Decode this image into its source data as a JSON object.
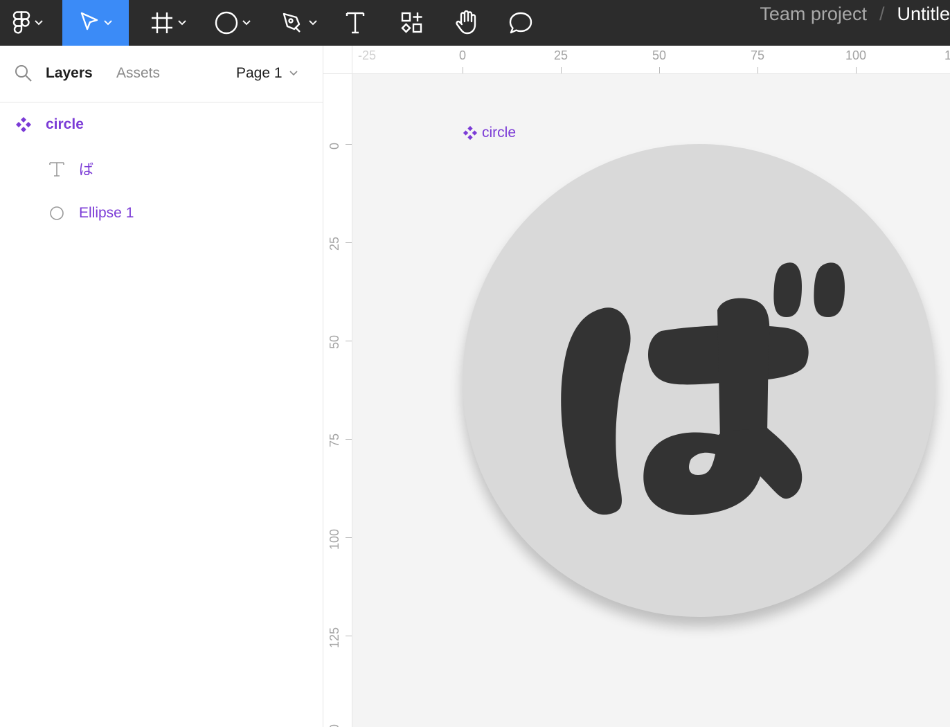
{
  "toolbar": {
    "tools": [
      {
        "name": "figma-menu",
        "icon": "figma-logo-icon"
      },
      {
        "name": "move-tool",
        "icon": "cursor-icon",
        "active": true
      },
      {
        "name": "frame-tool",
        "icon": "frame-icon"
      },
      {
        "name": "shape-tool",
        "icon": "ellipse-icon"
      },
      {
        "name": "pen-tool",
        "icon": "pen-icon"
      },
      {
        "name": "text-tool",
        "icon": "text-icon"
      },
      {
        "name": "resources-tool",
        "icon": "resources-icon"
      },
      {
        "name": "hand-tool",
        "icon": "hand-icon"
      },
      {
        "name": "comment-tool",
        "icon": "comment-icon"
      }
    ],
    "breadcrumb": {
      "team": "Team project",
      "separator": "/",
      "file": "Untitle"
    }
  },
  "left_panel": {
    "tabs": {
      "layers": "Layers",
      "assets": "Assets"
    },
    "page": "Page 1",
    "layers": [
      {
        "name": "circle",
        "type": "component",
        "icon": "component-icon"
      },
      {
        "name": "ば",
        "type": "text",
        "icon": "text-layer-icon"
      },
      {
        "name": "Ellipse 1",
        "type": "ellipse",
        "icon": "ellipse-layer-icon"
      }
    ]
  },
  "canvas": {
    "ruler_h": [
      "-25",
      "0",
      "25",
      "50",
      "75",
      "100",
      "1"
    ],
    "ruler_v": [
      "0",
      "25",
      "50",
      "75",
      "100",
      "125",
      "0"
    ],
    "frame_label": "circle",
    "glyph": "ば"
  },
  "colors": {
    "toolbar_bg": "#2c2c2c",
    "accent_blue": "#3b8bf7",
    "component_purple": "#7b3bd6",
    "canvas_bg": "#f4f4f4",
    "circle_fill": "#d9d9d9",
    "glyph_fill": "#333333"
  }
}
